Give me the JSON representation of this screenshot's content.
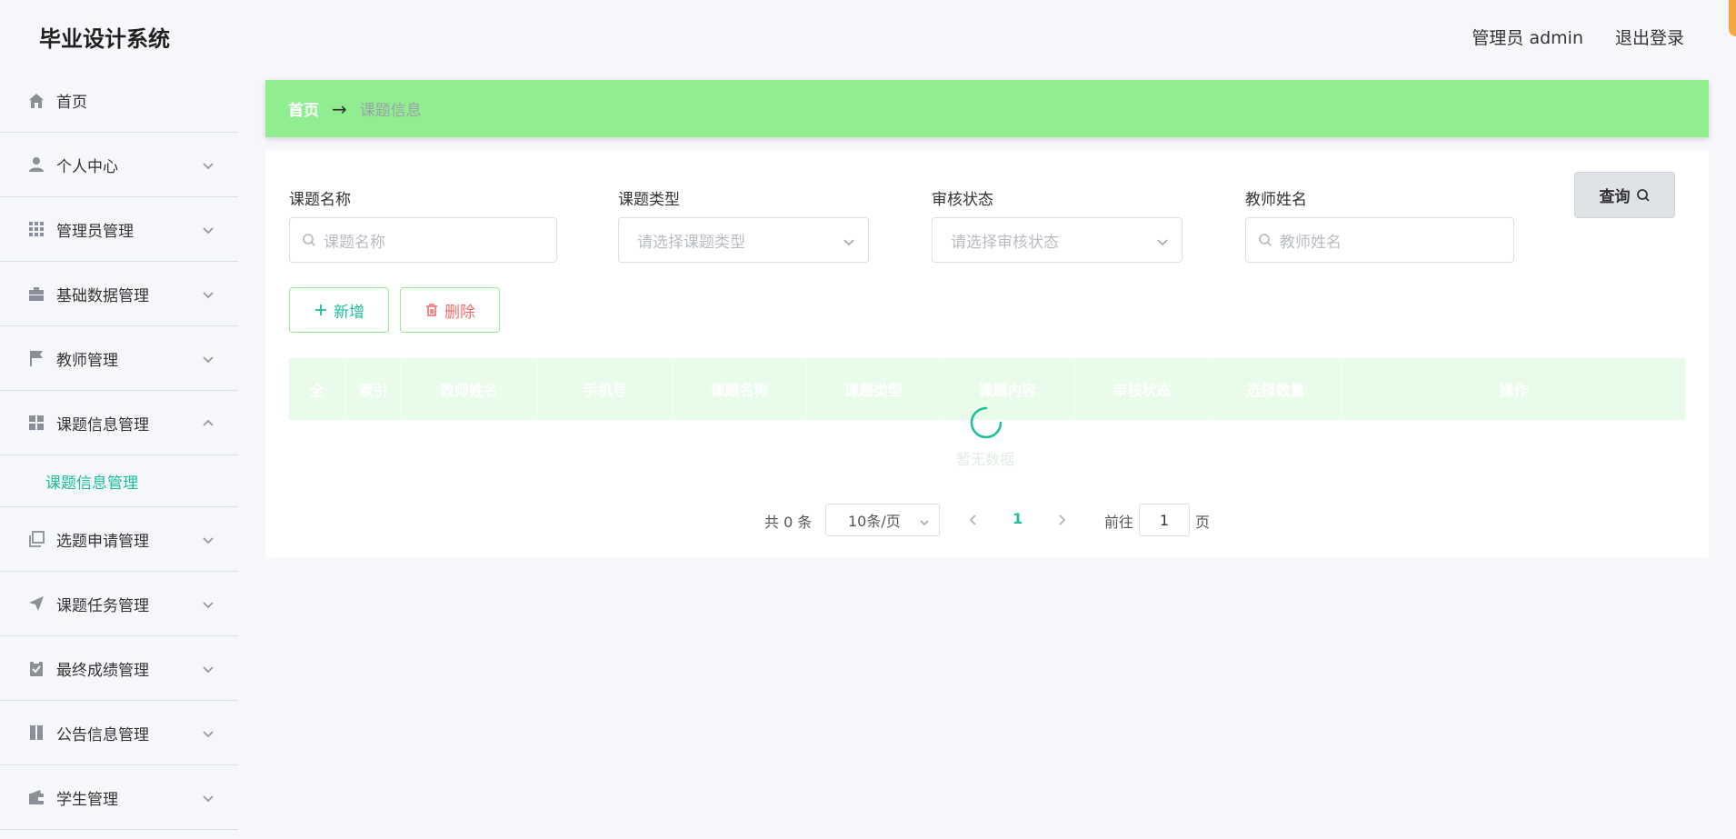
{
  "header": {
    "app_title": "毕业设计系统",
    "user_info": "管理员 admin",
    "logout": "退出登录"
  },
  "sidebar": {
    "items": [
      {
        "label": "首页",
        "icon": "home-icon"
      },
      {
        "label": "个人中心",
        "icon": "user-icon"
      },
      {
        "label": "管理员管理",
        "icon": "grid-icon"
      },
      {
        "label": "基础数据管理",
        "icon": "briefcase-icon"
      },
      {
        "label": "教师管理",
        "icon": "flag-icon"
      },
      {
        "label": "课题信息管理",
        "icon": "apps-icon",
        "expanded": true
      },
      {
        "label": "选题申请管理",
        "icon": "copy-icon"
      },
      {
        "label": "课题任务管理",
        "icon": "send-icon"
      },
      {
        "label": "最终成绩管理",
        "icon": "clipboard-icon"
      },
      {
        "label": "公告信息管理",
        "icon": "book-icon"
      },
      {
        "label": "学生管理",
        "icon": "wallet-icon"
      }
    ],
    "submenu_active": "课题信息管理"
  },
  "breadcrumb": {
    "home": "首页",
    "arrow": "→",
    "current": "课题信息"
  },
  "search": {
    "title_label": "课题名称",
    "title_placeholder": "课题名称",
    "type_label": "课题类型",
    "type_placeholder": "请选择课题类型",
    "status_label": "审核状态",
    "status_placeholder": "请选择审核状态",
    "teacher_label": "教师姓名",
    "teacher_placeholder": "教师姓名",
    "query_button": "查询"
  },
  "actions": {
    "add": "新增",
    "delete": "删除"
  },
  "table": {
    "columns": [
      "全",
      "索引",
      "教师姓名",
      "手机号",
      "课题名称",
      "课题类型",
      "课题内容",
      "审核状态",
      "选择数量",
      "操作"
    ],
    "empty_text": "暂无数据"
  },
  "pagination": {
    "total": "共 0 条",
    "page_size": "10条/页",
    "current_page": "1",
    "goto_label": "前往",
    "goto_value": "1",
    "goto_suffix": "页"
  },
  "colors": {
    "accent": "#1bbf9a",
    "breadcrumb_bg": "#90ee90",
    "danger": "#f56c6c"
  }
}
